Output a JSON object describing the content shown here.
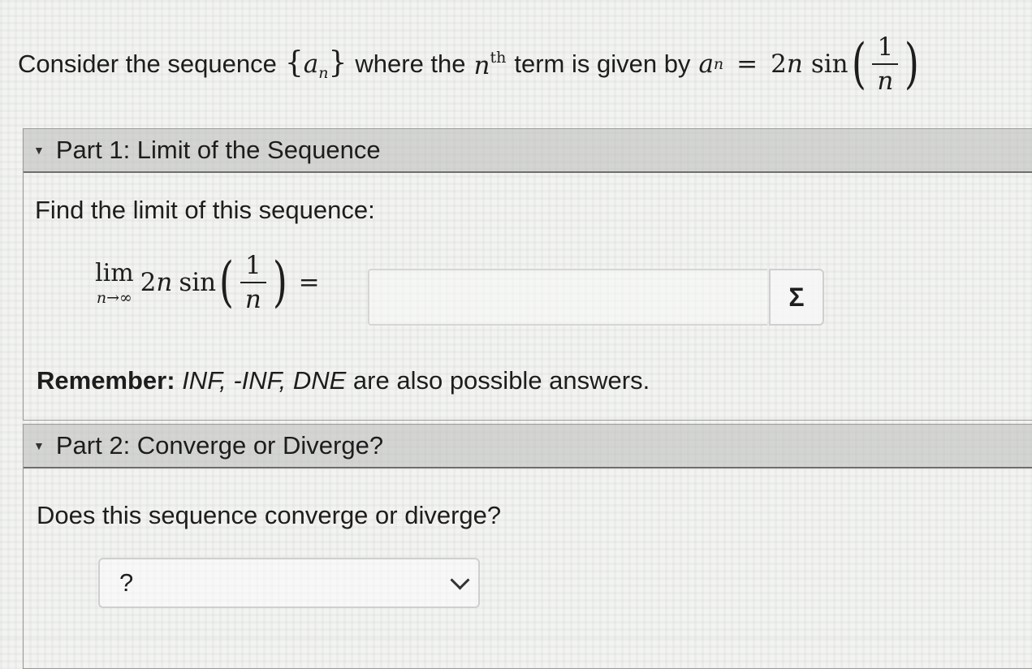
{
  "statement": {
    "prefix": "Consider the sequence",
    "seq_open": "{",
    "seq_var": "a",
    "seq_sub": "n",
    "seq_close": "}",
    "where": "where the",
    "n_var": "n",
    "th": "th",
    "term_text": "term is given by",
    "lhs_var": "a",
    "lhs_sub": "n",
    "equals": "=",
    "rhs_coef": "2",
    "rhs_var": "n",
    "func": "sin",
    "frac_num": "1",
    "frac_den": "n"
  },
  "part1": {
    "title": "Part 1: Limit of the Sequence",
    "prompt": "Find the limit of this sequence:",
    "limit": {
      "lim": "lim",
      "under": "n→∞",
      "coef": "2",
      "var": "n",
      "func": "sin",
      "frac_num": "1",
      "frac_den": "n",
      "equals": "="
    },
    "answer_value": "",
    "equation_editor_symbol": "Σ",
    "remember_label": "Remember:",
    "remember_options": "INF, -INF, DNE",
    "remember_tail": "are also possible answers."
  },
  "part2": {
    "title": "Part 2: Converge or Diverge?",
    "prompt": "Does this sequence converge or diverge?",
    "select_value": "?"
  },
  "icons": {
    "collapse": "caret-down-icon",
    "dropdown": "chevron-down-icon",
    "equation_editor": "sigma-icon"
  }
}
